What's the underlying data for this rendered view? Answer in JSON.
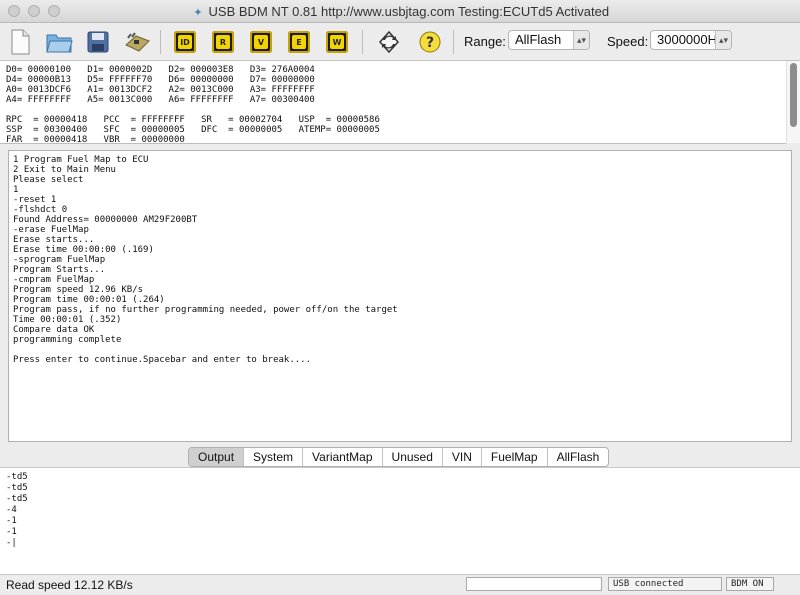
{
  "window": {
    "title": "USB BDM NT  0.81 http://www.usbjtag.com  Testing:ECUTd5  Activated"
  },
  "toolbar": {
    "buttons": [
      {
        "icon": "new-document-icon"
      },
      {
        "icon": "open-folder-icon"
      },
      {
        "icon": "save-disk-icon"
      },
      {
        "icon": "ecu-board-icon"
      },
      {
        "icon": "chip-id-icon",
        "text": "ID"
      },
      {
        "icon": "chip-read-icon",
        "text": "R"
      },
      {
        "icon": "chip-verify-icon",
        "text": "V"
      },
      {
        "icon": "chip-erase-icon",
        "text": "E"
      },
      {
        "icon": "chip-write-icon",
        "text": "W"
      },
      {
        "icon": "refresh-icon"
      },
      {
        "icon": "help-icon"
      }
    ],
    "range_label": "Range:",
    "range_value": "AllFlash",
    "speed_label": "Speed:",
    "speed_value": "3000000H"
  },
  "registers": {
    "lines": [
      "D0= 00000100   D1= 0000002D   D2= 000003E8   D3= 276A0004",
      "D4= 00000B13   D5= FFFFFF70   D6= 00000000   D7= 00000000",
      "A0= 0013DCF6   A1= 0013DCF2   A2= 0013C000   A3= FFFFFFFF",
      "A4= FFFFFFFF   A5= 0013C000   A6= FFFFFFFF   A7= 00300400",
      "",
      "RPC  = 00000418   PCC  = FFFFFFFF   SR   = 00002704   USP  = 00000586",
      "SSP  = 00300400   SFC  = 00000005   DFC  = 00000005   ATEMP= 00000005",
      "FAR  = 00000418   VBR  = 00000000"
    ]
  },
  "console": {
    "lines": [
      "1 Program Fuel Map to ECU",
      "2 Exit to Main Menu",
      "Please select",
      "1",
      "-reset 1",
      "-flshdct 0",
      "Found Address= 00000000 AM29F200BT",
      "-erase FuelMap",
      "Erase starts...",
      "Erase time 00:00:00 (.169)",
      "-sprogram FuelMap",
      "Program Starts...",
      "-cmpram FuelMap",
      "Program speed 12.96 KB/s",
      "Program time 00:00:01 (.264)",
      "Program pass, if no further programming needed, power off/on the target",
      "Time 00:00:01 (.352)",
      "Compare data OK",
      "programming complete",
      "",
      "Press enter to continue.Spacebar and enter to break...."
    ]
  },
  "tabs": [
    {
      "label": "Output",
      "active": true
    },
    {
      "label": "System",
      "active": false
    },
    {
      "label": "VariantMap",
      "active": false
    },
    {
      "label": "Unused",
      "active": false
    },
    {
      "label": "VIN",
      "active": false
    },
    {
      "label": "FuelMap",
      "active": false
    },
    {
      "label": "AllFlash",
      "active": false
    }
  ],
  "output": {
    "lines": [
      "-td5",
      "-td5",
      "-td5",
      "-4",
      "-1",
      "-1",
      "-|"
    ]
  },
  "status": {
    "read_speed": "Read speed 12.12 KB/s",
    "usb": "USB connected",
    "bdm": "BDM ON"
  }
}
